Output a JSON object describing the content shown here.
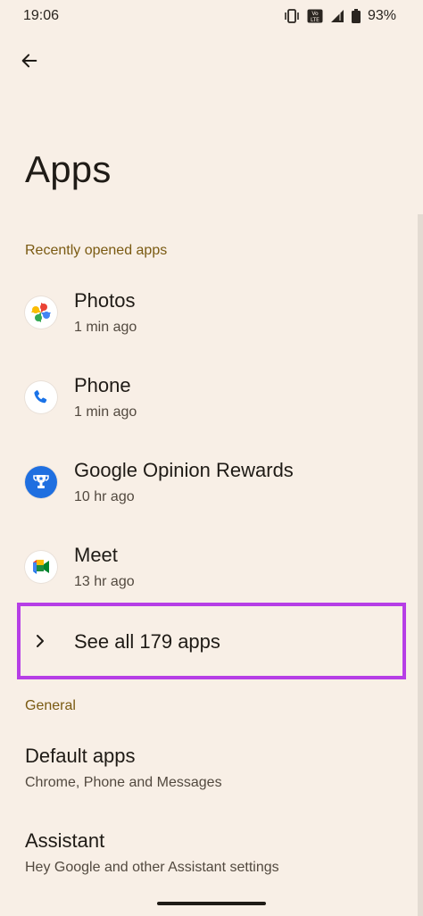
{
  "status_bar": {
    "time": "19:06",
    "battery_percent": "93%",
    "volte_label": "Vo LTE",
    "icons": [
      "vibrate-icon",
      "volte-icon",
      "signal-icon",
      "battery-icon"
    ]
  },
  "header": {
    "back_icon": "arrow-left-icon",
    "title": "Apps"
  },
  "recent": {
    "header": "Recently opened apps",
    "apps": [
      {
        "name": "Photos",
        "time": "1 min ago",
        "icon": "photos-icon"
      },
      {
        "name": "Phone",
        "time": "1 min ago",
        "icon": "phone-icon"
      },
      {
        "name": "Google Opinion Rewards",
        "time": "10 hr ago",
        "icon": "opinion-rewards-icon"
      },
      {
        "name": "Meet",
        "time": "13 hr ago",
        "icon": "meet-icon"
      }
    ],
    "see_all_label": "See all 179 apps"
  },
  "general": {
    "header": "General",
    "items": [
      {
        "title": "Default apps",
        "subtitle": "Chrome, Phone and Messages"
      },
      {
        "title": "Assistant",
        "subtitle": "Hey Google and other Assistant settings"
      }
    ]
  },
  "colors": {
    "background": "#f8efe6",
    "section_header": "#7a5a12",
    "highlight_border": "#b63ee6",
    "text_primary": "#1f1b16",
    "text_secondary": "#52493f"
  }
}
